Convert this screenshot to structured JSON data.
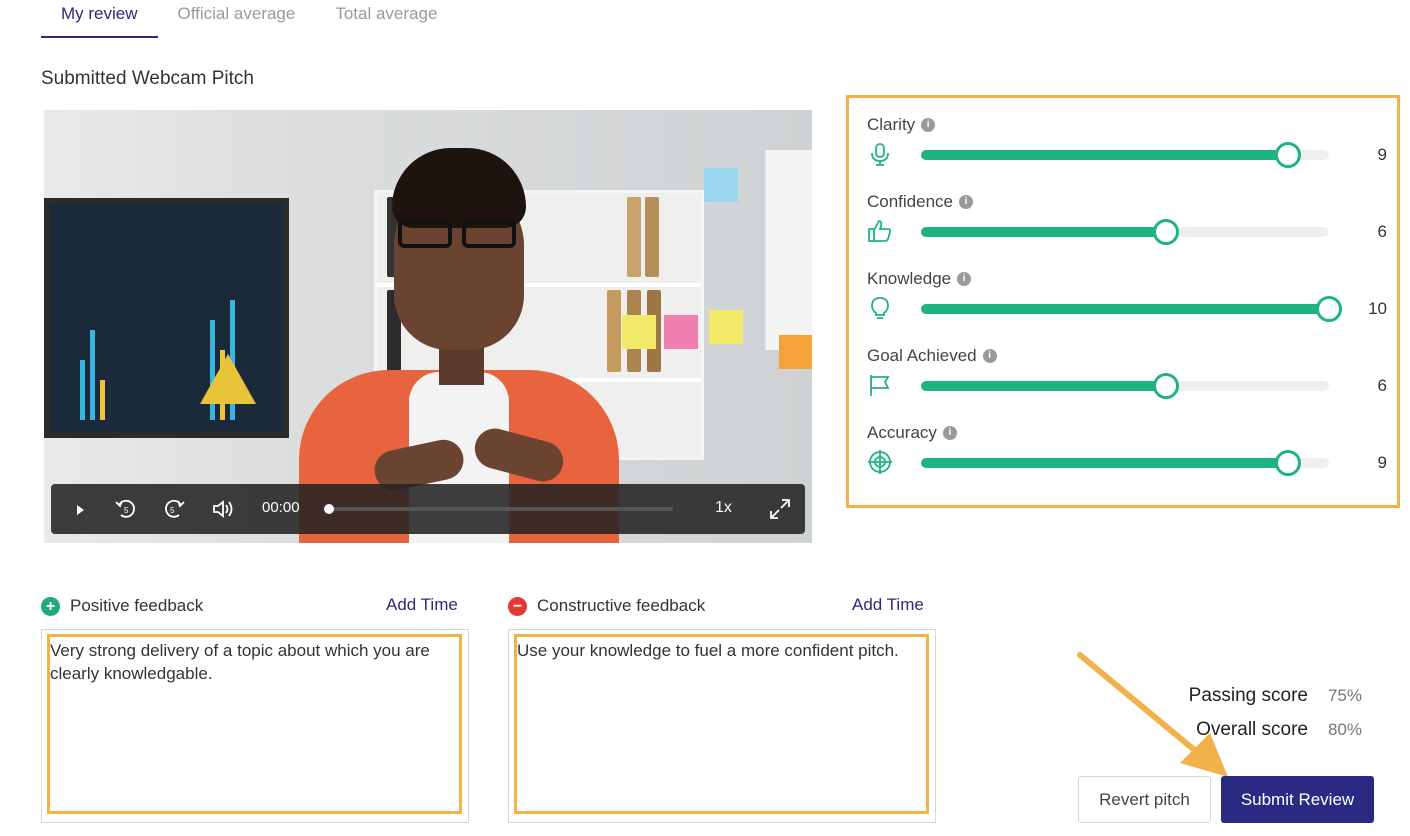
{
  "tabs": [
    {
      "label": "My review",
      "active": true
    },
    {
      "label": "Official average",
      "active": false
    },
    {
      "label": "Total average",
      "active": false
    }
  ],
  "section_title": "Submitted Webcam Pitch",
  "video": {
    "time": "00:00",
    "speed": "1x",
    "progress": 0
  },
  "ratings": [
    {
      "label": "Clarity",
      "icon": "microphone-icon",
      "value": 9,
      "max": 10,
      "fraction": 0.9
    },
    {
      "label": "Confidence",
      "icon": "thumbs-up-icon",
      "value": 6,
      "max": 10,
      "fraction": 0.6
    },
    {
      "label": "Knowledge",
      "icon": "lightbulb-icon",
      "value": 10,
      "max": 10,
      "fraction": 1.0
    },
    {
      "label": "Goal Achieved",
      "icon": "flag-icon",
      "value": 6,
      "max": 10,
      "fraction": 0.6
    },
    {
      "label": "Accuracy",
      "icon": "target-icon",
      "value": 9,
      "max": 10,
      "fraction": 0.9
    }
  ],
  "feedback": {
    "positive": {
      "title": "Positive feedback",
      "add_time": "Add Time",
      "text": "Very strong delivery of a topic about which you are clearly knowledgable."
    },
    "constructive": {
      "title": "Constructive feedback",
      "add_time": "Add Time",
      "text": "Use your knowledge to fuel a more confident pitch."
    }
  },
  "scores": {
    "passing_label": "Passing score",
    "passing_value": "75%",
    "overall_label": "Overall score",
    "overall_value": "80%"
  },
  "buttons": {
    "revert": "Revert pitch",
    "submit": "Submit Review"
  },
  "colors": {
    "accent": "#2b2a82",
    "slider": "#1fb384",
    "highlight": "#f2b14a",
    "positive": "#1fa97c",
    "negative": "#e53935"
  }
}
